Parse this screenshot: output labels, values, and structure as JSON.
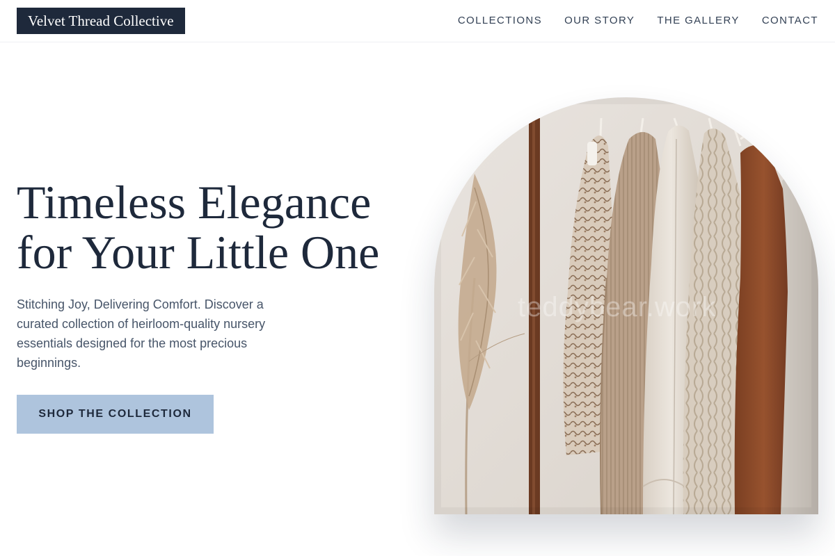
{
  "header": {
    "brand": "Velvet Thread Collective",
    "nav": [
      {
        "label": "COLLECTIONS"
      },
      {
        "label": "OUR STORY"
      },
      {
        "label": "THE GALLERY"
      },
      {
        "label": "CONTACT"
      }
    ]
  },
  "hero": {
    "title_line1": "Timeless Elegance",
    "title_line2": "for Your Little One",
    "subtitle": "Stitching Joy, Delivering Comfort. Discover a curated collection of heirloom-quality nursery essentials designed for the most precious beginnings.",
    "cta_label": "SHOP THE COLLECTION",
    "image_watermark": "teddybear.work"
  },
  "colors": {
    "brand_dark": "#1e293b",
    "cta_background": "#aec4dd",
    "text_muted": "#475569"
  }
}
